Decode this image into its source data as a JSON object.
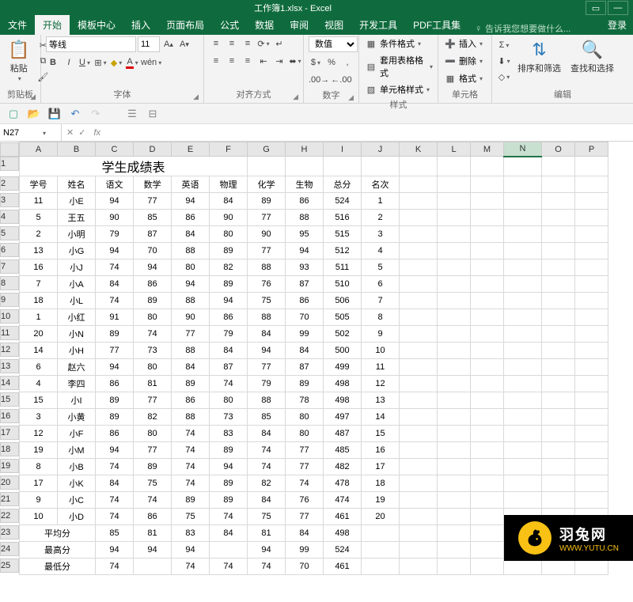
{
  "window": {
    "title": "工作簿1.xlsx - Excel"
  },
  "menu": {
    "items": [
      "文件",
      "开始",
      "模板中心",
      "插入",
      "页面布局",
      "公式",
      "数据",
      "审阅",
      "视图",
      "开发工具",
      "PDF工具集"
    ],
    "active": 1,
    "tell_me": "告诉我您想要做什么...",
    "login": "登录"
  },
  "ribbon": {
    "clipboard": {
      "paste": "粘贴",
      "label": "剪贴板"
    },
    "font": {
      "name": "等线",
      "size": "11",
      "label": "字体",
      "wen": "wén"
    },
    "align": {
      "label": "对齐方式"
    },
    "number": {
      "format": "数值",
      "label": "数字"
    },
    "styles": {
      "cond": "条件格式",
      "tbl": "套用表格格式",
      "cell": "单元格样式",
      "label": "样式"
    },
    "cells": {
      "ins": "插入",
      "del": "删除",
      "fmt": "格式",
      "label": "单元格"
    },
    "editing": {
      "sort": "排序和筛选",
      "find": "查找和选择",
      "label": "编辑"
    }
  },
  "formula_bar": {
    "name": "N27",
    "fx": "fx",
    "value": ""
  },
  "sheet": {
    "columns": [
      "A",
      "B",
      "C",
      "D",
      "E",
      "F",
      "G",
      "H",
      "I",
      "J",
      "K",
      "L",
      "M",
      "N",
      "O",
      "P"
    ],
    "selected_col": "N",
    "title": "学生成绩表",
    "headers": [
      "学号",
      "姓名",
      "语文",
      "数学",
      "英语",
      "物理",
      "化学",
      "生物",
      "总分",
      "名次"
    ],
    "rows": [
      [
        "11",
        "小E",
        "94",
        "77",
        "94",
        "84",
        "89",
        "86",
        "524",
        "1"
      ],
      [
        "5",
        "王五",
        "90",
        "85",
        "86",
        "90",
        "77",
        "88",
        "516",
        "2"
      ],
      [
        "2",
        "小明",
        "79",
        "87",
        "84",
        "80",
        "90",
        "95",
        "515",
        "3"
      ],
      [
        "13",
        "小G",
        "94",
        "70",
        "88",
        "89",
        "77",
        "94",
        "512",
        "4"
      ],
      [
        "16",
        "小J",
        "74",
        "94",
        "80",
        "82",
        "88",
        "93",
        "511",
        "5"
      ],
      [
        "7",
        "小A",
        "84",
        "86",
        "94",
        "89",
        "76",
        "87",
        "510",
        "6"
      ],
      [
        "18",
        "小L",
        "74",
        "89",
        "88",
        "94",
        "75",
        "86",
        "506",
        "7"
      ],
      [
        "1",
        "小红",
        "91",
        "80",
        "90",
        "86",
        "88",
        "70",
        "505",
        "8"
      ],
      [
        "20",
        "小N",
        "89",
        "74",
        "77",
        "79",
        "84",
        "99",
        "502",
        "9"
      ],
      [
        "14",
        "小H",
        "77",
        "73",
        "88",
        "84",
        "94",
        "84",
        "500",
        "10"
      ],
      [
        "6",
        "赵六",
        "94",
        "80",
        "84",
        "87",
        "77",
        "87",
        "499",
        "11"
      ],
      [
        "4",
        "李四",
        "86",
        "81",
        "89",
        "74",
        "79",
        "89",
        "498",
        "12"
      ],
      [
        "15",
        "小I",
        "89",
        "77",
        "86",
        "80",
        "88",
        "78",
        "498",
        "13"
      ],
      [
        "3",
        "小黄",
        "89",
        "82",
        "88",
        "73",
        "85",
        "80",
        "497",
        "14"
      ],
      [
        "12",
        "小F",
        "86",
        "80",
        "74",
        "83",
        "84",
        "80",
        "487",
        "15"
      ],
      [
        "19",
        "小M",
        "94",
        "77",
        "74",
        "89",
        "74",
        "77",
        "485",
        "16"
      ],
      [
        "8",
        "小B",
        "74",
        "89",
        "74",
        "94",
        "74",
        "77",
        "482",
        "17"
      ],
      [
        "17",
        "小K",
        "84",
        "75",
        "74",
        "89",
        "82",
        "74",
        "478",
        "18"
      ],
      [
        "9",
        "小C",
        "74",
        "74",
        "89",
        "89",
        "84",
        "76",
        "474",
        "19"
      ],
      [
        "10",
        "小D",
        "74",
        "86",
        "75",
        "74",
        "75",
        "77",
        "461",
        "20"
      ]
    ],
    "summary": [
      [
        "平均分",
        "",
        "85",
        "81",
        "83",
        "84",
        "81",
        "84",
        "498",
        ""
      ],
      [
        "最高分",
        "",
        "94",
        "94",
        "94",
        "",
        "94",
        "99",
        "524",
        ""
      ],
      [
        "最低分",
        "",
        "74",
        "",
        "74",
        "74",
        "74",
        "70",
        "461",
        ""
      ]
    ]
  },
  "watermark": {
    "name": "羽兔网",
    "url": "WWW.YUTU.CN"
  }
}
